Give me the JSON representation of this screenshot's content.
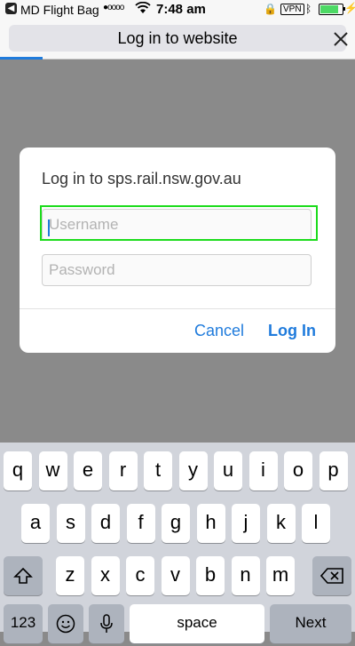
{
  "status_bar": {
    "carrier": "MD Flight Bag",
    "signal": "●oooo",
    "time": "7:48 am",
    "vpn": "VPN",
    "battery_level": 0.9,
    "battery_color": "#4cd964"
  },
  "nav": {
    "title": "Log in to website",
    "close_icon": "close-icon"
  },
  "dialog": {
    "title": "Log in to sps.rail.nsw.gov.au",
    "username_placeholder": "Username",
    "password_placeholder": "Password",
    "cancel_label": "Cancel",
    "login_label": "Log In"
  },
  "keyboard": {
    "row1": [
      "q",
      "w",
      "e",
      "r",
      "t",
      "y",
      "u",
      "i",
      "o",
      "p"
    ],
    "row2": [
      "a",
      "s",
      "d",
      "f",
      "g",
      "h",
      "j",
      "k",
      "l"
    ],
    "row3": [
      "z",
      "x",
      "c",
      "v",
      "b",
      "n",
      "m"
    ],
    "numbers_label": "123",
    "space_label": "space",
    "next_label": "Next",
    "shift_icon": "shift-icon",
    "delete_icon": "delete-icon",
    "emoji_icon": "emoji-icon",
    "mic_icon": "microphone-icon"
  },
  "colors": {
    "accent": "#1f7bdc",
    "focus_ring": "#1cdc1c",
    "overlay": "#8a8a8a"
  }
}
